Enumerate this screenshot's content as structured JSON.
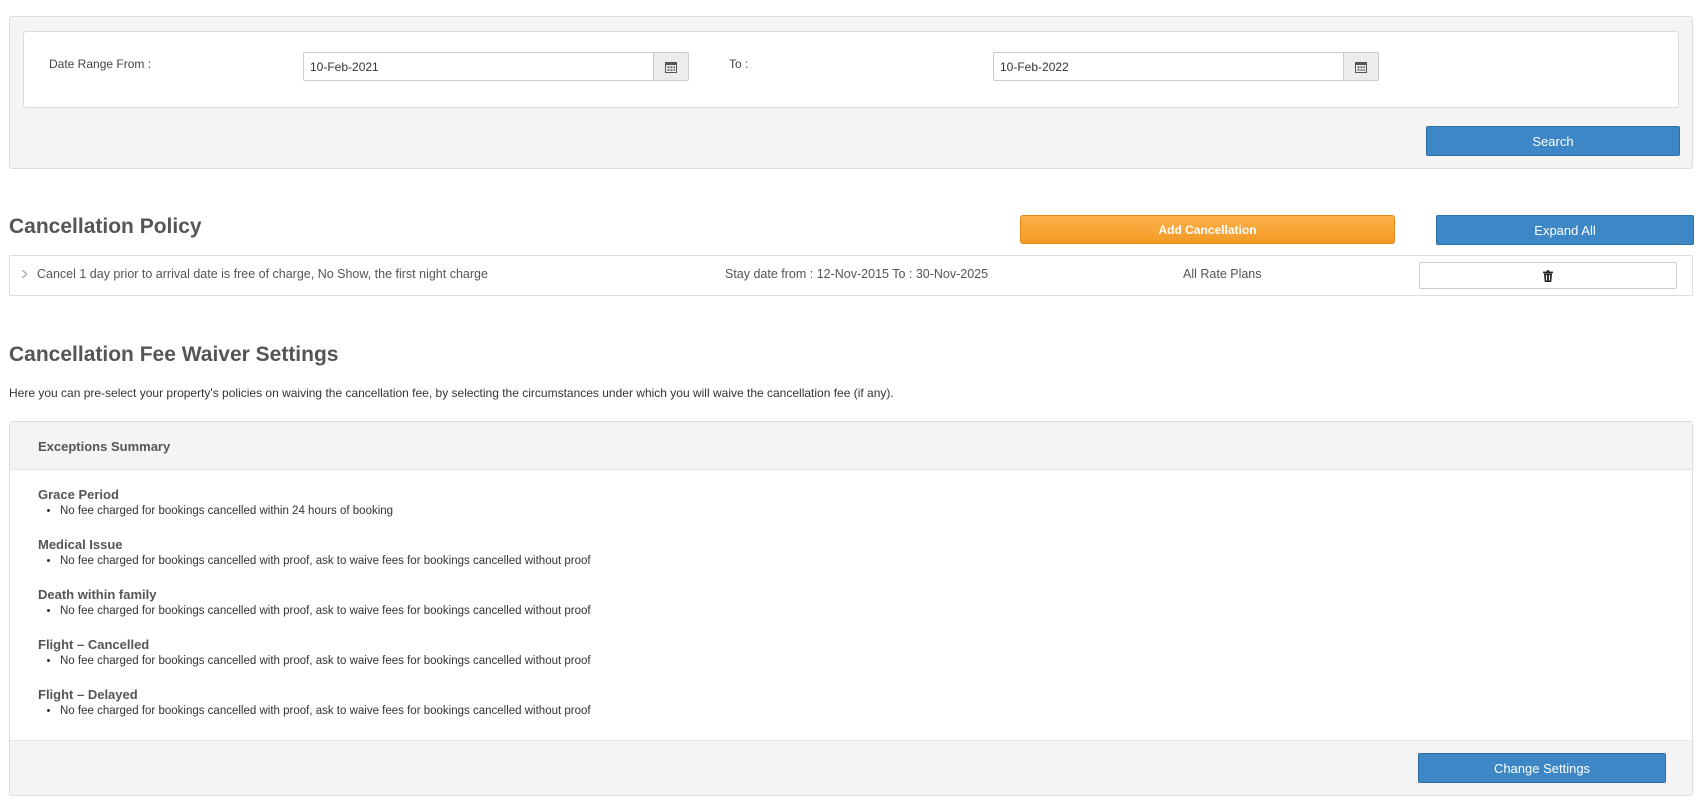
{
  "search": {
    "from_label": "Date Range From :",
    "from_value": "10-Feb-2021",
    "to_label": "To :",
    "to_value": "10-Feb-2022",
    "search_button": "Search",
    "calendar_icon": "calendar-icon"
  },
  "policy": {
    "title": "Cancellation Policy",
    "add_button": "Add Cancellation",
    "expand_button": "Expand All",
    "rows": [
      {
        "description": "Cancel 1 day prior to arrival date is free of charge, No Show, the first night charge",
        "stay_dates": "Stay date from : 12-Nov-2015 To : 30-Nov-2025",
        "rate_plans": "All Rate Plans",
        "delete_icon": "trash-icon",
        "expand_icon": "chevron-right-icon"
      }
    ]
  },
  "waiver": {
    "title": "Cancellation Fee Waiver Settings",
    "intro": "Here you can pre-select your property's policies on waiving the cancellation fee, by selecting the circumstances under which you will waive the cancellation fee (if any).",
    "summary_title": "Exceptions Summary",
    "groups": [
      {
        "title": "Grace Period",
        "item": "No fee charged for bookings cancelled within 24 hours of booking"
      },
      {
        "title": "Medical Issue",
        "item": "No fee charged for bookings cancelled with proof, ask to waive fees for bookings cancelled without proof"
      },
      {
        "title": "Death within family",
        "item": "No fee charged for bookings cancelled with proof, ask to waive fees for bookings cancelled without proof"
      },
      {
        "title": "Flight – Cancelled",
        "item": "No fee charged for bookings cancelled with proof, ask to waive fees for bookings cancelled without proof"
      },
      {
        "title": "Flight – Delayed",
        "item": "No fee charged for bookings cancelled with proof, ask to waive fees for bookings cancelled without proof"
      }
    ],
    "change_button": "Change Settings"
  },
  "colors": {
    "primary_blue": "#3d87c7",
    "accent_orange": "#f5a030",
    "panel_gray": "#f4f4f4",
    "heading_gray": "#555555"
  }
}
